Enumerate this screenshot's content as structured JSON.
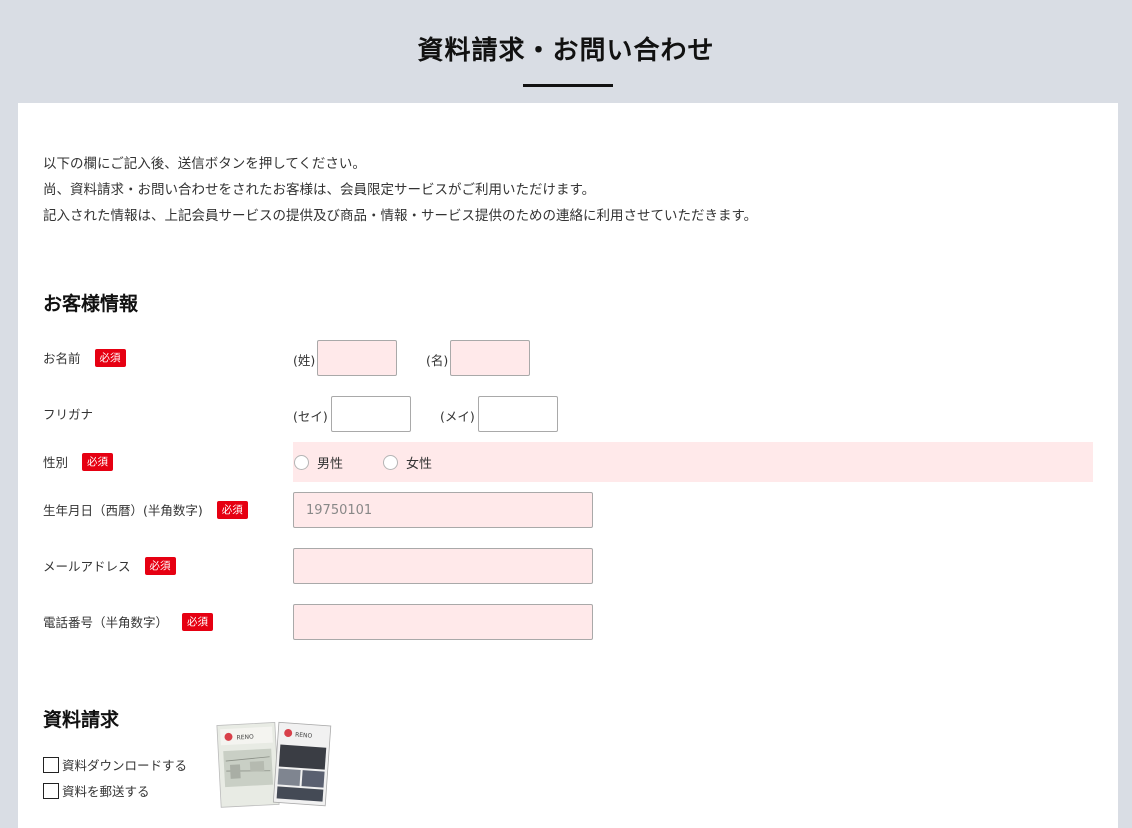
{
  "header": {
    "title": "資料請求・お問い合わせ"
  },
  "intro": {
    "lines": [
      "以下の欄にご記入後、送信ボタンを押してください。",
      "尚、資料請求・お問い合わせをされたお客様は、会員限定サービスがご利用いただけます。",
      "記入された情報は、上記会員サービスの提供及び商品・情報・サービス提供のための連絡に利用させていただきます。"
    ]
  },
  "customer": {
    "section_title": "お客様情報",
    "required_badge": "必須",
    "name": {
      "label": "お名前",
      "last_label": "(姓)",
      "first_label": "(名)",
      "last_value": "",
      "first_value": ""
    },
    "kana": {
      "label": "フリガナ",
      "last_label": "(セイ)",
      "first_label": "(メイ)",
      "last_value": "",
      "first_value": ""
    },
    "gender": {
      "label": "性別",
      "options": [
        "男性",
        "女性"
      ]
    },
    "birthday": {
      "label": "生年月日（西暦）(半角数字)",
      "value": "",
      "placeholder": "19750101"
    },
    "email": {
      "label": "メールアドレス",
      "value": ""
    },
    "phone": {
      "label": "電話番号（半角数字）",
      "value": ""
    }
  },
  "materials": {
    "section_title": "資料請求",
    "options": [
      "資料ダウンロードする",
      "資料を郵送する"
    ],
    "catalog_brand": "RENO"
  },
  "colors": {
    "background": "#d9dde4",
    "required_red": "#e60012",
    "required_field_bg": "#ffe9ea"
  }
}
